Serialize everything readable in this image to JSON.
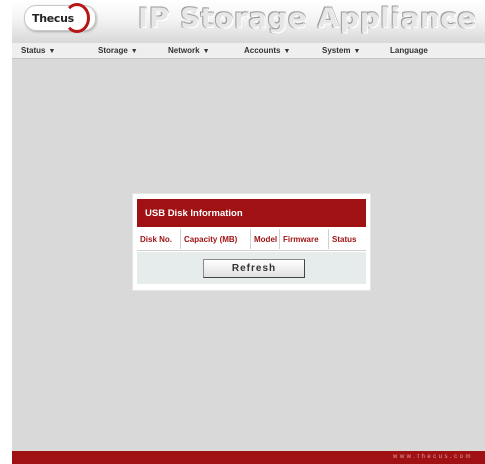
{
  "header": {
    "logo_text": "Thecus",
    "app_title": "IP Storage Appliance"
  },
  "menu": {
    "items": [
      {
        "label": "Status"
      },
      {
        "label": "Storage"
      },
      {
        "label": "Network"
      },
      {
        "label": "Accounts"
      },
      {
        "label": "System"
      },
      {
        "label": "Language"
      }
    ],
    "caret": "▼"
  },
  "dialog": {
    "title": "USB Disk Information",
    "columns": [
      "Disk No.",
      "Capacity (MB)",
      "Model",
      "Firmware",
      "Status"
    ],
    "refresh_label": "Refresh"
  },
  "footer": {
    "url": "www.thecus.com"
  },
  "colors": {
    "brand_red": "#9f1113",
    "background": "#d9d9d9"
  }
}
